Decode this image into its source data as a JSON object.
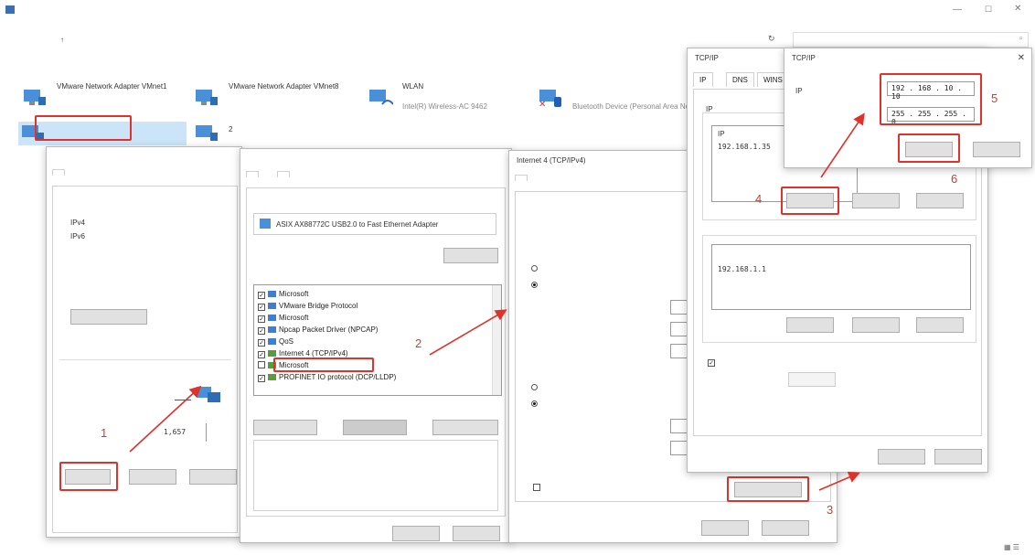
{
  "explorer": {
    "title": "",
    "breadcrumb": [
      ""
    ],
    "search_placeholder": "",
    "toolbar": [],
    "adapters": [
      {
        "name": "VMware Network Adapter VMnet1",
        "status": ""
      },
      {
        "name": "VMware Network Adapter VMnet8",
        "status": ""
      },
      {
        "name": "WLAN",
        "status": "",
        "device": "Intel(R) Wireless-AC 9462"
      },
      {
        "name": "",
        "status": "",
        "device": "Bluetooth Device (Personal Area Network)"
      },
      {
        "name": "",
        "status": ""
      },
      {
        "name": "2",
        "status": ""
      }
    ],
    "status_bar": {
      "count": "",
      "selected": ""
    }
  },
  "status_dialog": {
    "title": "",
    "tab": "",
    "section": "",
    "rows": [
      {
        "label": "IPv4",
        "value": ""
      },
      {
        "label": "IPv6",
        "value": ""
      },
      {
        "label": "",
        "value": ""
      },
      {
        "label": "",
        "value": ""
      },
      {
        "label": "",
        "value": ""
      }
    ],
    "details_button": "",
    "activity": "",
    "sent": "",
    "packets_label": "",
    "packets_value": "1,657",
    "properties_button": "",
    "disable_button": "",
    "diagnose_button": ""
  },
  "props_dialog": {
    "title": "",
    "tabs": [
      "",
      ""
    ],
    "connect_using_label": "",
    "adapter_name": "ASIX AX88772C USB2.0 to Fast Ethernet Adapter",
    "configure_button": "",
    "items_label": "",
    "items": [
      {
        "label": "Microsoft",
        "checked": true
      },
      {
        "label": "VMware Bridge Protocol",
        "checked": true
      },
      {
        "label": "Microsoft",
        "checked": true
      },
      {
        "label": "Npcap Packet Driver (NPCAP)",
        "checked": true
      },
      {
        "label": "QoS",
        "checked": true
      },
      {
        "label": "Internet 4 (TCP/IPv4)",
        "checked": true
      },
      {
        "label": "Microsoft",
        "checked": false
      },
      {
        "label": "PROFINET IO protocol (DCP/LLDP)",
        "checked": true
      }
    ],
    "install_button": "",
    "uninstall_button": "",
    "properties_button": "",
    "description_label": "",
    "description_text": "",
    "ok_button": "",
    "cancel_button": ""
  },
  "ipv4_dialog": {
    "title": "Internet 4 (TCP/IPv4)",
    "tab": "",
    "intro": "",
    "auto_ip": "",
    "manual_ip": "",
    "ip_label": "",
    "subnet_label": "",
    "gateway_label": "",
    "ip_value": "",
    "subnet_value": "",
    "gateway_value": "",
    "auto_dns": "",
    "manual_dns": "",
    "pref_dns": "",
    "alt_dns": "",
    "validate_label": "",
    "advanced_button": "",
    "ok_button": "",
    "cancel_button": ""
  },
  "advanced_dialog": {
    "title": "TCP/IP",
    "tabs": [
      "IP",
      "DNS",
      "WINS"
    ],
    "ip_section": "IP",
    "ip_header": "IP",
    "ip_entry": "192.168.1.35",
    "add_button": "",
    "edit_button": "",
    "remove_button": "",
    "gateway_section": "",
    "gw_header_1": "",
    "gw_header_2": "",
    "gw_entry": "192.168.1.1",
    "gw_metric": "",
    "gw_add": "",
    "gw_edit": "",
    "gw_remove": "",
    "auto_metric": "",
    "iface_metric": "",
    "ok_button": "",
    "cancel_button": ""
  },
  "tcpip_addr_dialog": {
    "title": "TCP/IP",
    "ip_label": "IP",
    "subnet_label": "",
    "ip_value": "192 . 168 . 10 . 10",
    "subnet_value": "255 . 255 . 255 . 0",
    "add_button": "",
    "cancel_button": ""
  },
  "steps": [
    "1",
    "2",
    "3",
    "4",
    "5",
    "6"
  ],
  "colors": {
    "annotation": "#e0322b",
    "selected": "#cce4f7"
  }
}
